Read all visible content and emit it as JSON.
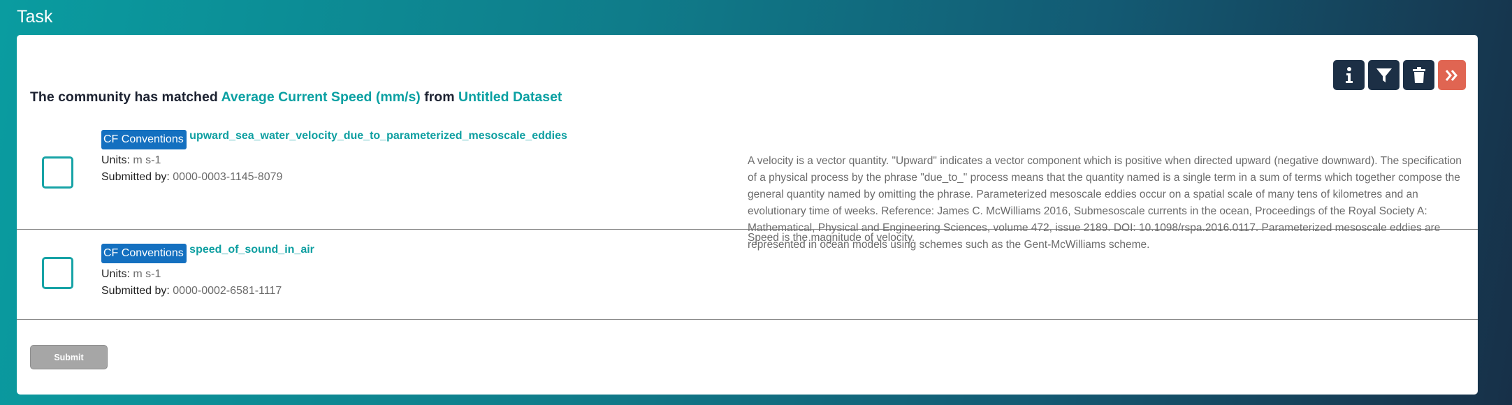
{
  "app": {
    "title": "Task"
  },
  "toolbar": {
    "info_icon": "info-icon",
    "filter_icon": "filter-icon",
    "delete_icon": "trash-icon",
    "next_icon": "double-chevron-right-icon",
    "next_color": "#e06552",
    "button_color": "#1c2f45"
  },
  "heading": {
    "prefix": "The community has matched",
    "variable": "Average Current Speed (mm/s)",
    "middle": "from",
    "dataset": "Untitled Dataset"
  },
  "matches": [
    {
      "badge": "CF Conventions",
      "name": "upward_sea_water_velocity_due_to_parameterized_mesoscale_eddies",
      "units_label": "Units:",
      "units": "m s-1",
      "submitted_label": "Submitted by:",
      "submitted_by": "0000-0003-1145-8079",
      "description": "A velocity is a vector quantity. \"Upward\" indicates a vector component which is positive when directed upward (negative downward). The specification of a physical process by the phrase \"due_to_\" process means that the quantity named is a single term in a sum of terms which together compose the general quantity named by omitting the phrase. Parameterized mesoscale eddies occur on a spatial scale of many tens of kilometres and an evolutionary time of weeks. Reference: James C. McWilliams 2016, Submesoscale currents in the ocean, Proceedings of the Royal Society A: Mathematical, Physical and Engineering Sciences, volume 472, issue 2189. DOI: 10.1098/rspa.2016.0117. Parameterized mesoscale eddies are represented in ocean models using schemes such as the Gent-McWilliams scheme."
    },
    {
      "badge": "CF Conventions",
      "name": "speed_of_sound_in_air",
      "units_label": "Units:",
      "units": "m s-1",
      "submitted_label": "Submitted by:",
      "submitted_by": "0000-0002-6581-1117",
      "description": "Speed is the magnitude of velocity."
    }
  ],
  "submit": {
    "label": "Submit"
  },
  "colors": {
    "accent": "#0aa0a2",
    "badge": "#1470c0",
    "submit_disabled": "#a6a6a6"
  }
}
